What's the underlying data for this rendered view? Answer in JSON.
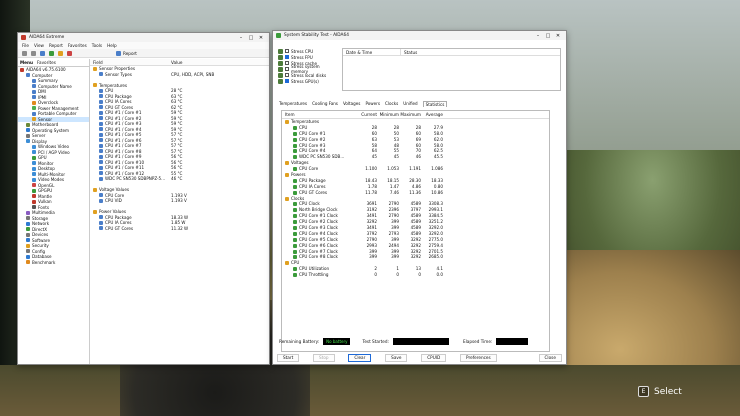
{
  "aida": {
    "title": "AIDA64 Extreme",
    "menu": [
      "File",
      "View",
      "Report",
      "Favorites",
      "Tools",
      "Help"
    ],
    "toolbar_report": "Report",
    "nav_tabs": [
      "Menu",
      "Favorites"
    ],
    "tree": [
      {
        "label": "AIDA64 v6.75.6100",
        "indent": 0,
        "icon": "#c0392b"
      },
      {
        "label": "Computer",
        "indent": 1,
        "icon": "#4a7ec9"
      },
      {
        "label": "Summary",
        "indent": 2,
        "icon": "#4a7ec9"
      },
      {
        "label": "Computer Name",
        "indent": 2,
        "icon": "#4a7ec9"
      },
      {
        "label": "DMI",
        "indent": 2,
        "icon": "#4a7ec9"
      },
      {
        "label": "IPMI",
        "indent": 2,
        "icon": "#4a7ec9"
      },
      {
        "label": "Overclock",
        "indent": 2,
        "icon": "#e08a1e"
      },
      {
        "label": "Power Management",
        "indent": 2,
        "icon": "#4caf50"
      },
      {
        "label": "Portable Computer",
        "indent": 2,
        "icon": "#4a7ec9"
      },
      {
        "label": "Sensor",
        "indent": 2,
        "icon": "#e0a020",
        "selected": true
      },
      {
        "label": "Motherboard",
        "indent": 1,
        "icon": "#6a8a3a"
      },
      {
        "label": "Operating System",
        "indent": 1,
        "icon": "#2e7ad1"
      },
      {
        "label": "Server",
        "indent": 1,
        "icon": "#777"
      },
      {
        "label": "Display",
        "indent": 1,
        "icon": "#3d8ed6"
      },
      {
        "label": "Windows Video",
        "indent": 2,
        "icon": "#3d8ed6"
      },
      {
        "label": "PCI / AGP Video",
        "indent": 2,
        "icon": "#3d8ed6"
      },
      {
        "label": "GPU",
        "indent": 2,
        "icon": "#3b9b3b"
      },
      {
        "label": "Monitor",
        "indent": 2,
        "icon": "#3d8ed6"
      },
      {
        "label": "Desktop",
        "indent": 2,
        "icon": "#3d8ed6"
      },
      {
        "label": "Multi-Monitor",
        "indent": 2,
        "icon": "#3d8ed6"
      },
      {
        "label": "Video Modes",
        "indent": 2,
        "icon": "#3d8ed6"
      },
      {
        "label": "OpenGL",
        "indent": 2,
        "icon": "#cc4444"
      },
      {
        "label": "GPGPU",
        "indent": 2,
        "icon": "#3b9b3b"
      },
      {
        "label": "Mantle",
        "indent": 2,
        "icon": "#c0392b"
      },
      {
        "label": "Vulkan",
        "indent": 2,
        "icon": "#c0392b"
      },
      {
        "label": "Fonts",
        "indent": 2,
        "icon": "#555"
      },
      {
        "label": "Multimedia",
        "indent": 1,
        "icon": "#8a5cc2"
      },
      {
        "label": "Storage",
        "indent": 1,
        "icon": "#777"
      },
      {
        "label": "Network",
        "indent": 1,
        "icon": "#2e7ad1"
      },
      {
        "label": "DirectX",
        "indent": 1,
        "icon": "#3b9b3b"
      },
      {
        "label": "Devices",
        "indent": 1,
        "icon": "#777"
      },
      {
        "label": "Software",
        "indent": 1,
        "icon": "#2e7ad1"
      },
      {
        "label": "Security",
        "indent": 1,
        "icon": "#e0a020"
      },
      {
        "label": "Config",
        "indent": 1,
        "icon": "#777"
      },
      {
        "label": "Database",
        "indent": 1,
        "icon": "#2e7ad1"
      },
      {
        "label": "Benchmark",
        "indent": 1,
        "icon": "#e08a1e"
      }
    ],
    "details_header": {
      "field": "Field",
      "value": "Value"
    },
    "details": [
      {
        "field": "Sensor Properties",
        "value": "",
        "group": true
      },
      {
        "field": "Sensor Types",
        "value": "CPU, HDD, ACPI, SNB",
        "indent": true
      },
      {
        "field": "",
        "value": ""
      },
      {
        "field": "Temperatures",
        "value": "",
        "group": true
      },
      {
        "field": "CPU",
        "value": "28 °C",
        "indent": true
      },
      {
        "field": "CPU Package",
        "value": "63 °C",
        "indent": true
      },
      {
        "field": "CPU IA Cores",
        "value": "63 °C",
        "indent": true
      },
      {
        "field": "CPU GT Cores",
        "value": "62 °C",
        "indent": true
      },
      {
        "field": "CPU #1 / Core #1",
        "value": "59 °C",
        "indent": true
      },
      {
        "field": "CPU #1 / Core #2",
        "value": "59 °C",
        "indent": true
      },
      {
        "field": "CPU #1 / Core #3",
        "value": "59 °C",
        "indent": true
      },
      {
        "field": "CPU #1 / Core #4",
        "value": "59 °C",
        "indent": true
      },
      {
        "field": "CPU #1 / Core #5",
        "value": "57 °C",
        "indent": true
      },
      {
        "field": "CPU #1 / Core #6",
        "value": "57 °C",
        "indent": true
      },
      {
        "field": "CPU #1 / Core #7",
        "value": "57 °C",
        "indent": true
      },
      {
        "field": "CPU #1 / Core #8",
        "value": "57 °C",
        "indent": true
      },
      {
        "field": "CPU #1 / Core #9",
        "value": "56 °C",
        "indent": true
      },
      {
        "field": "CPU #1 / Core #10",
        "value": "56 °C",
        "indent": true
      },
      {
        "field": "CPU #1 / Core #11",
        "value": "56 °C",
        "indent": true
      },
      {
        "field": "CPU #1 / Core #12",
        "value": "55 °C",
        "indent": true
      },
      {
        "field": "WDC PC SN530 SDBPNPZ-5...",
        "value": "46 °C",
        "indent": true
      },
      {
        "field": "",
        "value": ""
      },
      {
        "field": "Voltage Values",
        "value": "",
        "group": true
      },
      {
        "field": "CPU Core",
        "value": "1.193 V",
        "indent": true
      },
      {
        "field": "CPU VID",
        "value": "1.193 V",
        "indent": true
      },
      {
        "field": "",
        "value": ""
      },
      {
        "field": "Power Values",
        "value": "",
        "group": true
      },
      {
        "field": "CPU Package",
        "value": "18.33 W",
        "indent": true
      },
      {
        "field": "CPU IA Cores",
        "value": "1.85 W",
        "indent": true
      },
      {
        "field": "CPU GT Cores",
        "value": "11.32 W",
        "indent": true
      }
    ]
  },
  "sst": {
    "title": "System Stability Test - AIDA64",
    "stress": [
      {
        "label": "Stress CPU",
        "checked": false
      },
      {
        "label": "Stress FPU",
        "checked": true
      },
      {
        "label": "Stress cache",
        "checked": false
      },
      {
        "label": "Stress system memory",
        "checked": false
      },
      {
        "label": "Stress local disks",
        "checked": false
      },
      {
        "label": "Stress GPU(s)",
        "checked": true
      }
    ],
    "datebox_header": {
      "datetime": "Date & Time",
      "status": "Status"
    },
    "tabs": [
      "Temperatures",
      "Cooling Fans",
      "Voltages",
      "Powers",
      "Clocks",
      "Unified",
      "Statistics"
    ],
    "active_tab": "Statistics",
    "stats_header": {
      "item": "Item",
      "current": "Current",
      "minimum": "Minimum",
      "maximum": "Maximum",
      "average": "Average"
    },
    "stats": [
      {
        "item": "Temperatures",
        "group": true
      },
      {
        "item": "CPU",
        "cur": "28",
        "min": "28",
        "max": "28",
        "avg": "27.9"
      },
      {
        "item": "CPU Core #1",
        "cur": "60",
        "min": "50",
        "max": "60",
        "avg": "58.0"
      },
      {
        "item": "CPU Core #2",
        "cur": "63",
        "min": "53",
        "max": "69",
        "avg": "62.0"
      },
      {
        "item": "CPU Core #3",
        "cur": "58",
        "min": "48",
        "max": "60",
        "avg": "58.0"
      },
      {
        "item": "CPU Core #4",
        "cur": "64",
        "min": "55",
        "max": "70",
        "avg": "62.5"
      },
      {
        "item": "WDC PC SN530 SDB...",
        "cur": "45",
        "min": "45",
        "max": "46",
        "avg": "45.5"
      },
      {
        "item": "Voltages",
        "group": true
      },
      {
        "item": "CPU Core",
        "cur": "1.100",
        "min": "1.053",
        "max": "1.191",
        "avg": "1.086"
      },
      {
        "item": "Powers",
        "group": true
      },
      {
        "item": "CPU Package",
        "cur": "18.43",
        "min": "18.15",
        "max": "28.30",
        "avg": "18.33"
      },
      {
        "item": "CPU IA Cores",
        "cur": "1.78",
        "min": "1.47",
        "max": "4.86",
        "avg": "0.80"
      },
      {
        "item": "CPU GT Cores",
        "cur": "11.78",
        "min": "7.46",
        "max": "11.36",
        "avg": "10.86"
      },
      {
        "item": "Clocks",
        "group": true
      },
      {
        "item": "CPU Clock",
        "cur": "3691",
        "min": "2790",
        "max": "4589",
        "avg": "3308.3"
      },
      {
        "item": "North Bridge Clock",
        "cur": "3192",
        "min": "2396",
        "max": "3797",
        "avg": "2993.1"
      },
      {
        "item": "CPU Core #1 Clock",
        "cur": "3491",
        "min": "2790",
        "max": "4589",
        "avg": "3384.5"
      },
      {
        "item": "CPU Core #2 Clock",
        "cur": "3292",
        "min": "399",
        "max": "4589",
        "avg": "3251.2"
      },
      {
        "item": "CPU Core #3 Clock",
        "cur": "3491",
        "min": "399",
        "max": "4589",
        "avg": "3292.0"
      },
      {
        "item": "CPU Core #4 Clock",
        "cur": "3792",
        "min": "2793",
        "max": "4589",
        "avg": "3292.0"
      },
      {
        "item": "CPU Core #5 Clock",
        "cur": "2790",
        "min": "399",
        "max": "3292",
        "avg": "2775.0"
      },
      {
        "item": "CPU Core #6 Clock",
        "cur": "2993",
        "min": "2494",
        "max": "3292",
        "avg": "2759.4"
      },
      {
        "item": "CPU Core #7 Clock",
        "cur": "399",
        "min": "399",
        "max": "3292",
        "avg": "2701.5"
      },
      {
        "item": "CPU Core #8 Clock",
        "cur": "399",
        "min": "399",
        "max": "3292",
        "avg": "2685.0"
      },
      {
        "item": "CPU",
        "group": true
      },
      {
        "item": "CPU Utilization",
        "cur": "2",
        "min": "1",
        "max": "13",
        "avg": "4.1"
      },
      {
        "item": "CPU Throttling",
        "cur": "0",
        "min": "0",
        "max": "0",
        "avg": "0.0"
      }
    ],
    "status": {
      "battery_label": "Remaining Battery:",
      "battery_value": "No battery",
      "test_started_label": "Test Started:",
      "elapsed_label": "Elapsed Time:"
    },
    "buttons": {
      "start": "Start",
      "stop": "Stop",
      "clear": "Clear",
      "save": "Save",
      "cpuid": "CPUID",
      "preferences": "Preferences",
      "close": "Close"
    }
  },
  "game": {
    "select_key": "E",
    "select_label": "Select"
  }
}
